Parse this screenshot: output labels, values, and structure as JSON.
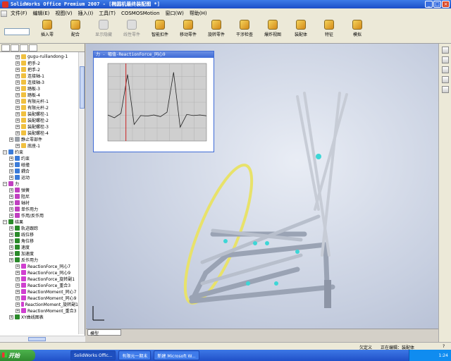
{
  "window": {
    "title": "SolidWorks Office Premium 2007 - [椭圆机最终装配图 *]"
  },
  "menu": [
    "文件(F)",
    "编辑(E)",
    "视图(V)",
    "插入(I)",
    "工具(T)",
    "COSMOSMotion",
    "窗口(W)",
    "帮助(H)"
  ],
  "toolbar": {
    "items": [
      {
        "label": "插入零",
        "disabled": false
      },
      {
        "label": "配合",
        "disabled": false
      },
      {
        "label": "显示隐藏",
        "disabled": true
      },
      {
        "label": "线性零件",
        "disabled": true
      },
      {
        "label": "智能扣件",
        "disabled": false
      },
      {
        "label": "移动零件",
        "disabled": false
      },
      {
        "label": "旋转零件",
        "disabled": false
      },
      {
        "label": "干涉检查",
        "disabled": false
      },
      {
        "label": "爆炸视图",
        "disabled": false
      },
      {
        "label": "装配体",
        "disabled": false
      },
      {
        "label": "特征",
        "disabled": false
      },
      {
        "label": "模拟",
        "disabled": false
      }
    ]
  },
  "tree": {
    "items": [
      {
        "label": "gugu-ruiliandong-1",
        "depth": 2,
        "color": "#f0c040"
      },
      {
        "label": "把手-2",
        "depth": 2,
        "color": "#f0c040"
      },
      {
        "label": "把手-2",
        "depth": 2,
        "color": "#f0c040"
      },
      {
        "label": "连接轴-1",
        "depth": 2,
        "color": "#f0c040"
      },
      {
        "label": "连接轴-3",
        "depth": 2,
        "color": "#f0c040"
      },
      {
        "label": "踏板-3",
        "depth": 2,
        "color": "#f0c040"
      },
      {
        "label": "踏板-4",
        "depth": 2,
        "color": "#f0c040"
      },
      {
        "label": "有限元杆-1",
        "depth": 2,
        "color": "#f0c040"
      },
      {
        "label": "有限元杆-2",
        "depth": 2,
        "color": "#f0c040"
      },
      {
        "label": "装配螺栓-1",
        "depth": 2,
        "color": "#f0c040"
      },
      {
        "label": "装配螺栓-2",
        "depth": 2,
        "color": "#f0c040"
      },
      {
        "label": "装配螺栓-3",
        "depth": 2,
        "color": "#f0c040"
      },
      {
        "label": "装配螺栓-4",
        "depth": 2,
        "color": "#f0c040"
      },
      {
        "label": "静止零部件",
        "depth": 1,
        "color": "#9aa0a8"
      },
      {
        "label": "底座-1",
        "depth": 2,
        "color": "#f0c040"
      },
      {
        "label": "约束",
        "depth": 0,
        "color": "#3b7bd8"
      },
      {
        "label": "约束",
        "depth": 1,
        "color": "#3b7bd8"
      },
      {
        "label": "碰撞",
        "depth": 1,
        "color": "#3b7bd8"
      },
      {
        "label": "耦合",
        "depth": 1,
        "color": "#3b7bd8"
      },
      {
        "label": "运动",
        "depth": 1,
        "color": "#3b7bd8"
      },
      {
        "label": "力",
        "depth": 0,
        "color": "#c040c0"
      },
      {
        "label": "弹簧",
        "depth": 1,
        "color": "#c040c0"
      },
      {
        "label": "阻尼",
        "depth": 1,
        "color": "#c040c0"
      },
      {
        "label": "轴衬",
        "depth": 1,
        "color": "#c040c0"
      },
      {
        "label": "单作用力",
        "depth": 1,
        "color": "#c040c0"
      },
      {
        "label": "作用/反作用",
        "depth": 1,
        "color": "#c040c0"
      },
      {
        "label": "结果",
        "depth": 0,
        "color": "#2a8a2a"
      },
      {
        "label": "轨迹跟踪",
        "depth": 1,
        "color": "#2a8a2a"
      },
      {
        "label": "线位移",
        "depth": 1,
        "color": "#2a8a2a"
      },
      {
        "label": "角位移",
        "depth": 1,
        "color": "#2a8a2a"
      },
      {
        "label": "速度",
        "depth": 1,
        "color": "#2a8a2a"
      },
      {
        "label": "加速度",
        "depth": 1,
        "color": "#2a8a2a"
      },
      {
        "label": "反作用力",
        "depth": 1,
        "color": "#2a8a2a"
      },
      {
        "label": "ReactionForce_同心7",
        "depth": 2,
        "color": "#d040d0"
      },
      {
        "label": "ReactionForce_同心9",
        "depth": 2,
        "color": "#d040d0"
      },
      {
        "label": "ReactionForce_旋转副1",
        "depth": 2,
        "color": "#d040d0"
      },
      {
        "label": "ReactionForce_重合3",
        "depth": 2,
        "color": "#d040d0"
      },
      {
        "label": "ReactionMoment_同心7",
        "depth": 2,
        "color": "#d040d0"
      },
      {
        "label": "ReactionMoment_同心9",
        "depth": 2,
        "color": "#d040d0"
      },
      {
        "label": "ReactionMoment_旋转副1",
        "depth": 2,
        "color": "#d040d0"
      },
      {
        "label": "ReactionMoment_重合3",
        "depth": 2,
        "color": "#d040d0"
      },
      {
        "label": "XY曲线图表",
        "depth": 1,
        "color": "#2a8a2a"
      }
    ]
  },
  "plot": {
    "title": "力 - 幅值-ReactionForce_同心9",
    "line_color": "#222222",
    "marker_color": "#cc2222"
  },
  "chart_data": {
    "type": "line",
    "title": "",
    "xlabel": "",
    "ylabel": "",
    "x": [
      0,
      0.2,
      0.4,
      0.6,
      0.8,
      1.0,
      1.2,
      1.4,
      1.6,
      1.8,
      2.0,
      2.2,
      2.4,
      2.6,
      2.8,
      3.0
    ],
    "values": [
      470,
      420,
      500,
      1200,
      300,
      460,
      450,
      470,
      440,
      520,
      1240,
      250,
      480,
      460,
      470,
      455
    ],
    "ylim": [
      0,
      1400
    ],
    "xlim": [
      0,
      3
    ],
    "grid": true
  },
  "viewport": {
    "tab_label": "模型"
  },
  "status": {
    "left": "欠定义",
    "middle": "正在编辑：装配体",
    "right": "?"
  },
  "taskbar": {
    "start_label": "开始",
    "tasks": [
      "SolidWorks Offic...",
      "有限元一期末",
      "新建 Microsoft W..."
    ],
    "clock": "1:24"
  }
}
